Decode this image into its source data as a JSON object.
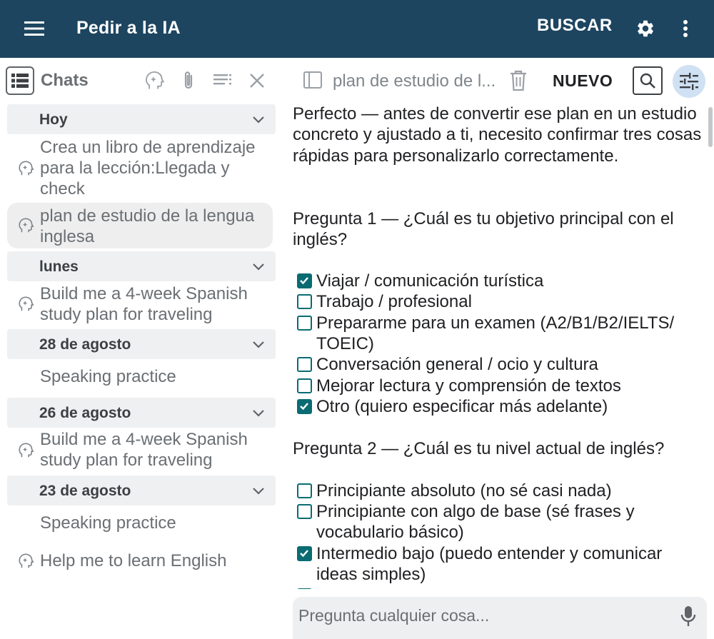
{
  "appbar": {
    "title": "Pedir a la IA",
    "search_label": "BUSCAR",
    "color": "#1d4560"
  },
  "sidebar": {
    "title": "Chats",
    "header_icons": [
      "list-icon",
      "ai-head-icon",
      "paperclip-icon",
      "sort-list-icon",
      "close-icon"
    ],
    "groups": [
      {
        "label": "Hoy"
      },
      {
        "label": "lunes"
      },
      {
        "label": "28 de agosto"
      },
      {
        "label": "26 de agosto"
      },
      {
        "label": "23 de agosto"
      }
    ],
    "chats": [
      {
        "text": "Crea un libro de aprendizaje para la lección:Llegada y check",
        "icon": "ai-head-icon"
      },
      {
        "text": "plan de estudio de la lengua inglesa",
        "icon": "ai-head-icon",
        "active": true
      },
      {
        "text": "Build me a 4-week Spanish study plan for traveling",
        "icon": "ai-head-icon"
      },
      {
        "text": "Speaking practice",
        "icon": ""
      },
      {
        "text": "Build me a 4-week Spanish study plan for traveling",
        "icon": "ai-head-icon"
      },
      {
        "text": "Speaking practice",
        "icon": ""
      },
      {
        "text": "Help me to learn English",
        "icon": "ai-head-icon"
      }
    ]
  },
  "main": {
    "conversation_title": "plan de estudio de l...",
    "new_label": "NUEVO",
    "tune_button_color": "#cfe1f3",
    "intro": "Perfecto — antes de convertir ese plan en un estudio concreto y ajustado a ti, necesito confirmar tres cosas rápidas para personalizarlo correctamente.",
    "question1": "Pregunta 1 — ¿Cuál es tu objetivo principal con el inglés?",
    "options1": [
      {
        "label": "Viajar / comunicación turística",
        "checked": true
      },
      {
        "label": "Trabajo / profesional",
        "checked": false
      },
      {
        "label": "Prepararme para un examen (A2/B1/B2/IELTS/ TOEIC)",
        "checked": false
      },
      {
        "label": "Conversación general / ocio y cultura",
        "checked": false
      },
      {
        "label": "Mejorar lectura y comprensión de textos",
        "checked": false
      },
      {
        "label": "Otro (quiero especificar más adelante)",
        "checked": true
      }
    ],
    "question2": "Pregunta 2 — ¿Cuál es tu nivel actual de inglés?",
    "options2": [
      {
        "label": "Principiante absoluto (no sé casi nada)",
        "checked": false
      },
      {
        "label": "Principiante con algo de base (sé frases y vocabulario básico)",
        "checked": false
      },
      {
        "label": "Intermedio bajo (puedo entender y comunicar ideas simples)",
        "checked": true
      },
      {
        "label": "",
        "checked": true
      }
    ],
    "checkbox_color": "#0a6b73"
  },
  "input": {
    "placeholder": "Pregunta cualquier cosa...",
    "value": ""
  }
}
